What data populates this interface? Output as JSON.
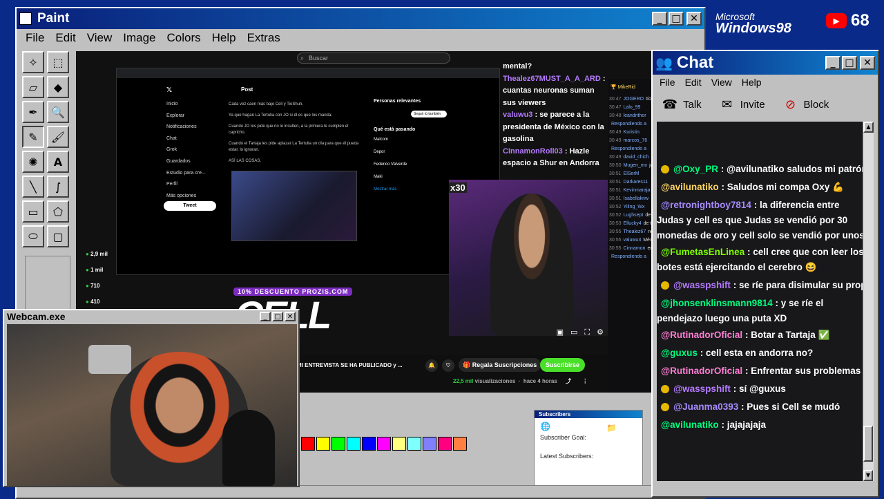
{
  "paint": {
    "title": "Paint",
    "menu": [
      "File",
      "Edit",
      "View",
      "Image",
      "Colors",
      "Help",
      "Extras"
    ],
    "palette": [
      "#ff0000",
      "#ffff00",
      "#00ff00",
      "#00ffff",
      "#0000ff",
      "#ff00ff",
      "#ffff80",
      "#80ffff",
      "#8080ff",
      "#ff0080",
      "#ff8040"
    ]
  },
  "stream_page": {
    "search_placeholder": "Buscar",
    "overlay_texts": [
      "10% DESCUENTO PROZIS.COM",
      "CELL"
    ],
    "video_title": "MI ENTREVISTA SE HA PUBLICADO y ...",
    "views": "22,5 mil",
    "views_label": "visualizaciones",
    "age": "hace 4 horas",
    "gift_button": "Regala Suscripciones",
    "subscribe_button": "Suscribirse",
    "side_stats": [
      "2,9 mil",
      "1 mil",
      "710",
      "410"
    ],
    "left_nav": [
      "Inicio",
      "Explorar",
      "Notificaciones",
      "Chat",
      "Grok",
      "Guardados",
      "Estudio para cre...",
      "Perfil",
      "Más opciones"
    ],
    "tweet_button": "Tweet",
    "post_header": "Post",
    "post_lines": [
      "Cada vez caen más bajo Cell y TioShun.",
      "Ya que hagan La Tertulia con JO si él es que los manda.",
      "Cuando JO les pide que no lo insulten, a la primera le cumplen el capricho.",
      "Cuando el Tartaja les pide aplazar La Tertulia un día para que él pueda estar, lo ignoran.",
      "ASÍ LAS COSAS."
    ],
    "right_panel_title": "Personas relevantes",
    "follow_button": "Seguir tú también",
    "trending_title": "Qué está pasando",
    "trending": [
      "Malcom",
      "Depor",
      "Federico Valverde",
      "Maki"
    ],
    "show_more": "Mostrar más",
    "x30_label": "x30",
    "overlay_chat": [
      {
        "user": "",
        "text": "mental?"
      },
      {
        "user": "Thealez67MUST_A_A_ARD",
        "text": ": cuantas neuronas suman sus viewers"
      },
      {
        "user": "valuwu3",
        "text": ": se parece a la presidenta de México con la gasolina"
      },
      {
        "user": "CinnamonRoll03",
        "text": ": Hazle espacio a Shur en Andorra"
      }
    ],
    "mini_chat": [
      {
        "time": "30:47",
        "user": "JOGERO",
        "text": "tío"
      },
      {
        "time": "30:47",
        "user": "Lalo_99",
        "text": ""
      },
      {
        "time": "30:48",
        "user": "leandrithor",
        "text": ""
      },
      {
        "time": "",
        "user": "Respondiendo a",
        "text": ""
      },
      {
        "time": "30:49",
        "user": "Kuristin",
        "text": ""
      },
      {
        "time": "30:49",
        "user": "marcos_76",
        "text": ""
      },
      {
        "time": "",
        "user": "Respondiendo a",
        "text": ""
      },
      {
        "time": "30:49",
        "user": "david_chich",
        "text": ""
      },
      {
        "time": "30:50",
        "user": "Mugen_mx",
        "text": "jajajaja"
      },
      {
        "time": "30:51",
        "user": "ElSerM",
        "text": ""
      },
      {
        "time": "30:51",
        "user": "Darkares11",
        "text": ""
      },
      {
        "time": "30:51",
        "user": "Kevinmaraja",
        "text": ""
      },
      {
        "time": "30:51",
        "user": "Isabellaknw",
        "text": ""
      },
      {
        "time": "30:52",
        "user": "Yiling_Wx",
        "text": ""
      },
      {
        "time": "30:52",
        "user": "Lughsept",
        "text": "de un país a otro"
      },
      {
        "time": "30:53",
        "user": "Ellucky4",
        "text": "de titanes tiene alg"
      },
      {
        "time": "30:55",
        "user": "Thealez67",
        "text": "neuronas suman s"
      },
      {
        "time": "30:55",
        "user": "valuwu3",
        "text": "México con la gas"
      },
      {
        "time": "30:55",
        "user": "Cinnamon",
        "text": "en Andorra"
      },
      {
        "time": "",
        "user": "Respondiendo a",
        "text": ""
      }
    ],
    "mini_chat_top_user": "MikeRid"
  },
  "chat": {
    "title": "Chat",
    "menu": [
      "File",
      "Edit",
      "View",
      "Help"
    ],
    "tools": [
      {
        "icon": "phone-icon",
        "label": "Talk"
      },
      {
        "icon": "invite-icon",
        "label": "Invite"
      },
      {
        "icon": "block-icon",
        "label": "Block"
      }
    ],
    "messages": [
      {
        "badge": true,
        "user": "@Oxy_PR",
        "color": "#00ff7f",
        "text": ": @avilunatiko saludos mi patrón"
      },
      {
        "badge": false,
        "user": "@avilunatiko",
        "color": "#ffd75e",
        "text": ": Saludos mi compa Oxy 💪"
      },
      {
        "badge": false,
        "user": "@retronightboy7814",
        "color": "#a78bff",
        "text": ": la diferencia entre Judas y cell es que Judas se vendió por 30 monedas de oro y cell solo se vendió por unos pocos views de valor"
      },
      {
        "badge": false,
        "user": "@FumetasEnLinea",
        "color": "#7fff00",
        "text": ": cell cree que con leer los botes está ejercitando el cerebro 😆"
      },
      {
        "badge": true,
        "user": "@wasspshift",
        "color": "#b57bff",
        "text": ": se ríe para disimular su propia ignorancia"
      },
      {
        "badge": false,
        "user": "@jhonsenklinsmann9814",
        "color": "#00ff7f",
        "text": ": y se ríe el pendejazo luego una puta XD"
      },
      {
        "badge": false,
        "user": "@RutinadorOficial",
        "color": "#ff7fd4",
        "text": ": Botar a Tartaja ✅"
      },
      {
        "badge": false,
        "user": "@guxus",
        "color": "#00ff7f",
        "text": ": cell esta en andorra no?"
      },
      {
        "badge": false,
        "user": "@RutinadorOficial",
        "color": "#ff7fd4",
        "text": ": Enfrentar sus problemas ❌"
      },
      {
        "badge": true,
        "user": "@wasspshift",
        "color": "#b57bff",
        "text": ": sí @guxus"
      },
      {
        "badge": true,
        "user": "@Juanma0393",
        "color": "#a78bff",
        "text": ": Pues si Cell se mudó"
      },
      {
        "badge": false,
        "user": "@avilunatiko",
        "color": "#00ff7f",
        "text": ": jajajajaja"
      }
    ]
  },
  "webcam": {
    "title": "Webcam.exe"
  },
  "logo": {
    "microsoft": "Microsoft",
    "windows": "Windows98"
  },
  "youtube": {
    "count": "68"
  },
  "subscribers": {
    "title": "Subscribers",
    "goal_label": "Subscriber Goal:",
    "latest_label": "Latest Subscribers:"
  },
  "colors": {
    "win_blue": "#0a1f7a",
    "face": "#c0c0c0",
    "chat_bg": "#18181b",
    "subscribe": "#4ae02a"
  }
}
